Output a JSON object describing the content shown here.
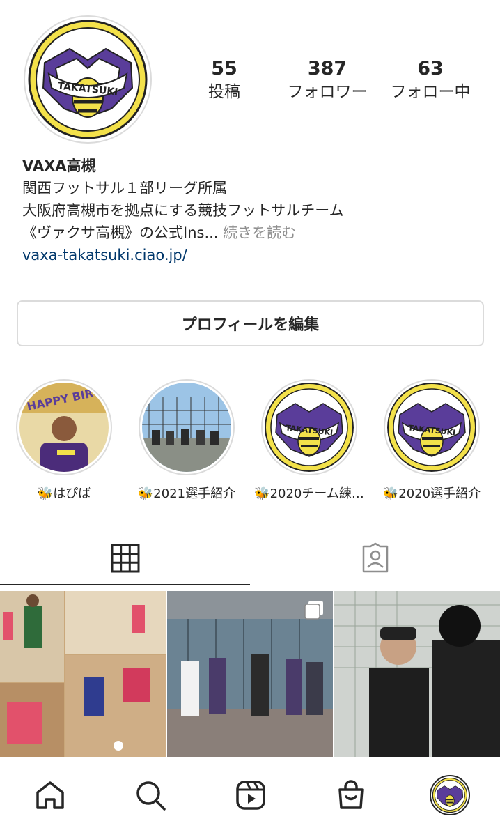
{
  "profile": {
    "team_logo_text": "TAKATSUKI",
    "stats": [
      {
        "value": "55",
        "label": "投稿"
      },
      {
        "value": "387",
        "label": "フォロワー"
      },
      {
        "value": "63",
        "label": "フォロー中"
      }
    ],
    "name": "VAXA高槻",
    "bio_line1": "関西フットサル１部リーグ所属",
    "bio_line2": "大阪府高槻市を拠点にする競技フットサルチーム",
    "bio_line3": "《ヴァクサ高槻》の公式Ins...",
    "bio_more": "続きを読む",
    "link": "vaxa-takatsuki.ciao.jp/",
    "edit_button": "プロフィールを編集"
  },
  "highlights": [
    {
      "label": "🐝はぴば",
      "icon": "birthday-photo"
    },
    {
      "label": "🐝2021選手紹介",
      "icon": "field-photo"
    },
    {
      "label": "🐝2020チーム練…",
      "icon": "team-logo"
    },
    {
      "label": "🐝2020選手紹介",
      "icon": "team-logo"
    }
  ],
  "tabs": [
    {
      "name": "grid",
      "icon": "grid-icon",
      "active": true
    },
    {
      "name": "tagged",
      "icon": "tagged-person-icon",
      "active": false
    }
  ],
  "posts": [
    {
      "icon": "collage-photo"
    },
    {
      "icon": "group-photo",
      "multi": true
    },
    {
      "icon": "coach-photo"
    }
  ],
  "nav": [
    "home-icon",
    "search-icon",
    "reels-icon",
    "shop-icon",
    "profile-avatar"
  ],
  "colors": {
    "purple": "#5a3d9a",
    "yellow": "#f3e14a",
    "link": "#00376b",
    "border": "#dbdbdb"
  }
}
